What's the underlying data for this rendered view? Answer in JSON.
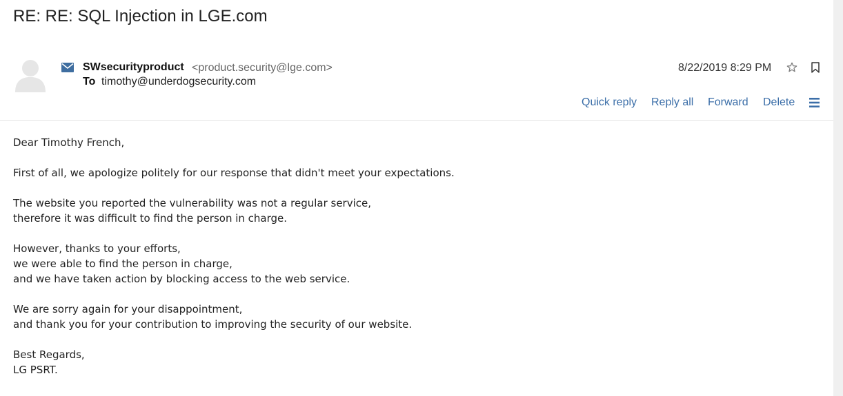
{
  "message": {
    "subject": "RE: RE: SQL Injection in LGE.com",
    "sender_name": "SWsecurityproduct",
    "sender_email": "<product.security@lge.com>",
    "to_label": "To",
    "to_value": "timothy@underdogsecurity.com",
    "date": "8/22/2019 8:29 PM"
  },
  "actions": {
    "quick_reply": "Quick reply",
    "reply_all": "Reply all",
    "forward": "Forward",
    "delete": "Delete"
  },
  "icons": {
    "avatar": "person-silhouette-icon",
    "mail": "envelope-icon",
    "star": "star-icon",
    "bookmark": "bookmark-icon",
    "menu": "hamburger-menu-icon"
  },
  "colors": {
    "link": "#3b6ea8",
    "envelope": "#3f6ea0",
    "avatar": "#e6e6e6"
  },
  "body": {
    "greeting": "Dear Timothy French,",
    "p1": "First of all, we apologize politely for our response that didn't meet your expectations.",
    "p2_l1": "The website you reported the vulnerability was not a regular service,",
    "p2_l2": "therefore it was difficult to find the person in charge.",
    "p3_l1": "However, thanks to your efforts,",
    "p3_l2": "we were able to find the person in charge,",
    "p3_l3": "and we have taken action by blocking access to the web service.",
    "p4_l1": "We are sorry again for your disappointment,",
    "p4_l2": "and thank you for your contribution to improving the security of our website.",
    "sig_l1": "Best Regards,",
    "sig_l2": "LG PSRT."
  }
}
